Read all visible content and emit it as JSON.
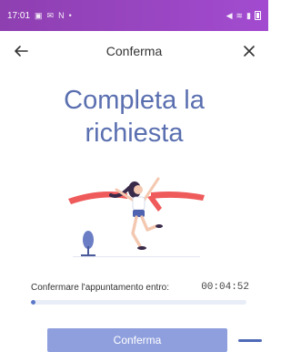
{
  "status_bar": {
    "time": "17:01",
    "left_icons": [
      "gallery-icon",
      "mail-icon",
      "n-icon"
    ],
    "right_icons": [
      "mute-icon",
      "wifi-icon",
      "signal-icon",
      "battery-icon"
    ]
  },
  "header": {
    "title": "Conferma"
  },
  "headline": {
    "line1": "Completa la",
    "line2": "richiesta"
  },
  "confirm": {
    "label": "Confermare l'appuntamento entro:",
    "countdown": "00:04:52",
    "progress_fraction": 0.02
  },
  "button": {
    "label": "Conferma"
  },
  "colors": {
    "accent": "#5a6fb0",
    "button": "#8f9fdd",
    "status_bar": "#9a45c4",
    "ribbon": "#ef5a5a"
  }
}
